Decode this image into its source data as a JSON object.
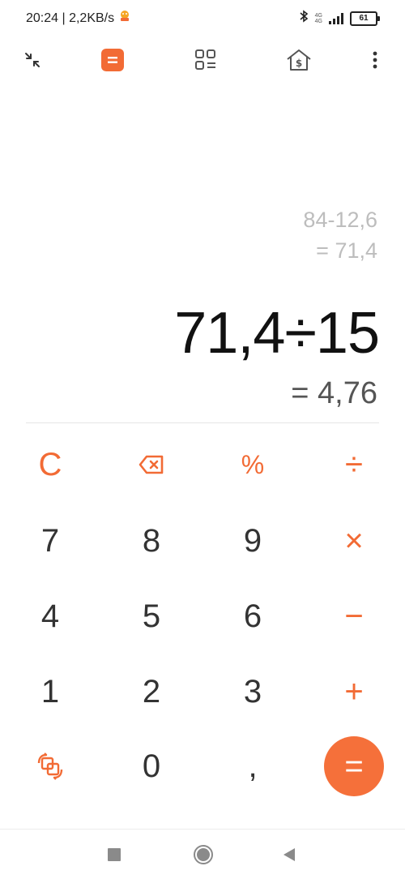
{
  "status_bar": {
    "time_speed": "20:24 | 2,2KB/s",
    "network_top": "4G",
    "network_bottom": "4G",
    "battery": "61"
  },
  "toolbar": {
    "items": [
      "collapse-icon",
      "calculator-icon",
      "converter-icon",
      "currency-icon",
      "more-icon"
    ]
  },
  "display": {
    "history_expression": "84-12,6",
    "history_result": "= 71,4",
    "current_expression": "71,4÷15",
    "current_result": "= 4,76"
  },
  "keypad": {
    "clear": "C",
    "percent": "%",
    "divide": "÷",
    "seven": "7",
    "eight": "8",
    "nine": "9",
    "multiply": "×",
    "four": "4",
    "five": "5",
    "six": "6",
    "minus": "−",
    "one": "1",
    "two": "2",
    "three": "3",
    "plus": "+",
    "zero": "0",
    "comma": ",",
    "equals": "="
  },
  "colors": {
    "accent": "#f26b35",
    "history_text": "#bdbdbd"
  }
}
